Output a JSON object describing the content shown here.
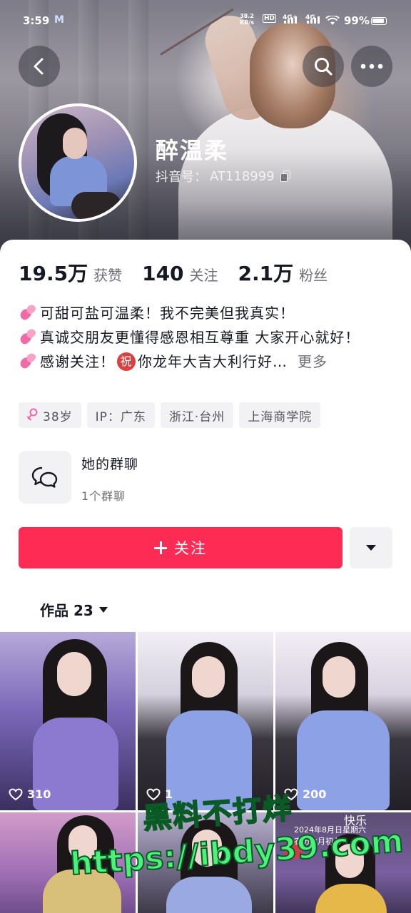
{
  "status_bar": {
    "time": "3:59",
    "app_badge": "M",
    "net_speed_value": "38.2",
    "net_speed_unit": "KB/s",
    "hd_label": "HD",
    "sim1_label": "4G+",
    "sim2_label": "4G",
    "battery": "99%"
  },
  "header": {
    "nickname": "醉温柔",
    "account_label": "抖音号：",
    "account_id": "AT118999"
  },
  "stats": [
    {
      "value": "19.5万",
      "label": "获赞"
    },
    {
      "value": "140",
      "label": "关注"
    },
    {
      "value": "2.1万",
      "label": "粉丝"
    }
  ],
  "bio": {
    "line1": "可甜可盐可温柔！我不完美但我真实！",
    "line2": "真诚交朋友更懂得感恩相互尊重 大家开心就好！",
    "line3_a": "感谢关注！",
    "zhu_badge": "祝",
    "line3_b": "你龙年大吉大利行好…",
    "more": "更多"
  },
  "tags": {
    "age": "38岁",
    "ip": "IP：广东",
    "region": "浙江·台州",
    "school": "上海商学院"
  },
  "group_chat": {
    "title": "她的群聊",
    "count": "1个群聊"
  },
  "follow_button": "关注",
  "works_tab": "作品 23",
  "grid": {
    "likes": [
      "310",
      "1",
      "200"
    ],
    "overlay_a": "快乐",
    "overlay_b": "2024年8月日星期六",
    "overlay_c": "农历七月初七"
  },
  "watermark": {
    "line1": "黑料不打烊",
    "line2": "https://ibdy39.com"
  },
  "colors": {
    "follow_red": "#fe2c55",
    "text_primary": "#161823",
    "text_secondary": "#6e6f76",
    "tag_bg": "#f2f2f4",
    "watermark_green": "#4cf07a"
  },
  "icons": [
    "back-arrow-icon",
    "search-icon",
    "more-icon",
    "copy-icon",
    "female-icon",
    "group-chat-icon",
    "plus-icon",
    "chevron-down-icon",
    "heart-outline-icon",
    "heart-emoji-icon"
  ]
}
